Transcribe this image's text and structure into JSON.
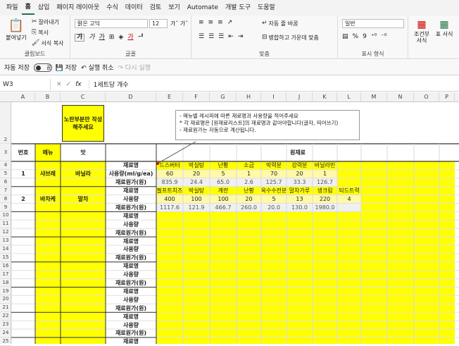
{
  "menu": [
    "파일",
    "홈",
    "삽입",
    "페이지 레이아웃",
    "수식",
    "데이터",
    "검토",
    "보기",
    "Automate",
    "개발 도구",
    "도움말"
  ],
  "menu_active": "홈",
  "ribbon": {
    "clipboard": {
      "paste": "붙여넣기",
      "cut": "잘라내기",
      "copy": "복사",
      "format_painter": "서식 복사",
      "label": "클립보드"
    },
    "font": {
      "name": "맑은 고딕",
      "size": "12",
      "label": "글꼴"
    },
    "align": {
      "wrap": "자동 줄 바꿈",
      "merge": "병합하고 가운데 맞춤",
      "label": "맞춤"
    },
    "number": {
      "format": "일반",
      "label": "표시 형식"
    },
    "styles": {
      "cond": "조건부 서식",
      "table": "표 서식"
    }
  },
  "qat": {
    "autosave": "자동 저장",
    "toggle_state": "끔",
    "save": "저장",
    "undo": "실행 취소",
    "redo": "다시 실행"
  },
  "formula": {
    "cell": "W3",
    "fx": "fx",
    "content": "1세트당 개수"
  },
  "columns": [
    "A",
    "B",
    "C",
    "D",
    "E",
    "F",
    "G",
    "H",
    "I",
    "J",
    "K",
    "L",
    "M",
    "N",
    "O",
    "P"
  ],
  "rows": [
    "2",
    "3",
    "4",
    "5",
    "6",
    "7",
    "8",
    "9",
    "10",
    "11",
    "12",
    "13",
    "14",
    "15",
    "16",
    "17",
    "18",
    "19",
    "20",
    "21",
    "22",
    "23",
    "24",
    "25"
  ],
  "sheet": {
    "prompt": "노란부분만 작성해주세요",
    "headers": {
      "no": "번호",
      "menu": "메뉴",
      "taste": "맛",
      "material": "원재료"
    },
    "items": [
      {
        "no": "1",
        "menu": "샤브레",
        "taste": "바닐라",
        "labels": [
          "재료명",
          "사용량(ml/g/ea)",
          "재료원가(원)"
        ],
        "names": [
          "드스버터",
          "박실탕",
          "난황",
          "소금",
          "박력분",
          "강력분",
          "바닐라빈"
        ],
        "qty": [
          "60",
          "20",
          "5",
          "1",
          "70",
          "20",
          "1"
        ],
        "cost": [
          "835.9",
          "24.4",
          "65.0",
          "2.6",
          "125.7",
          "33.3",
          "126.7"
        ]
      },
      {
        "no": "2",
        "menu": "바차케",
        "taste": "말차",
        "labels": [
          "재료명",
          "사용량",
          "재료원가(원)"
        ],
        "names": [
          "필프트치즈",
          "박실탕",
          "계란",
          "난황",
          "옥수수전분",
          "말차가루",
          "생크림",
          "되드트력"
        ],
        "qty": [
          "400",
          "100",
          "100",
          "20",
          "5",
          "13",
          "220",
          "4"
        ],
        "cost": [
          "1117.6",
          "121.9",
          "466.7",
          "260.0",
          "20.0",
          "130.0",
          "1980.0",
          ""
        ]
      }
    ],
    "empty_labels": [
      "재료명",
      "사용량",
      "재료원가(원)"
    ]
  },
  "note": [
    "- 메뉴별 레시피에 따른 재료명과 사용량을 적어주세요",
    "* 각 재료명은 [원재료리스트]의 재료명과 같아야합니다(글자, 띄어쓰기)",
    "- 재료원가는 자동으로 계산됩니다."
  ]
}
